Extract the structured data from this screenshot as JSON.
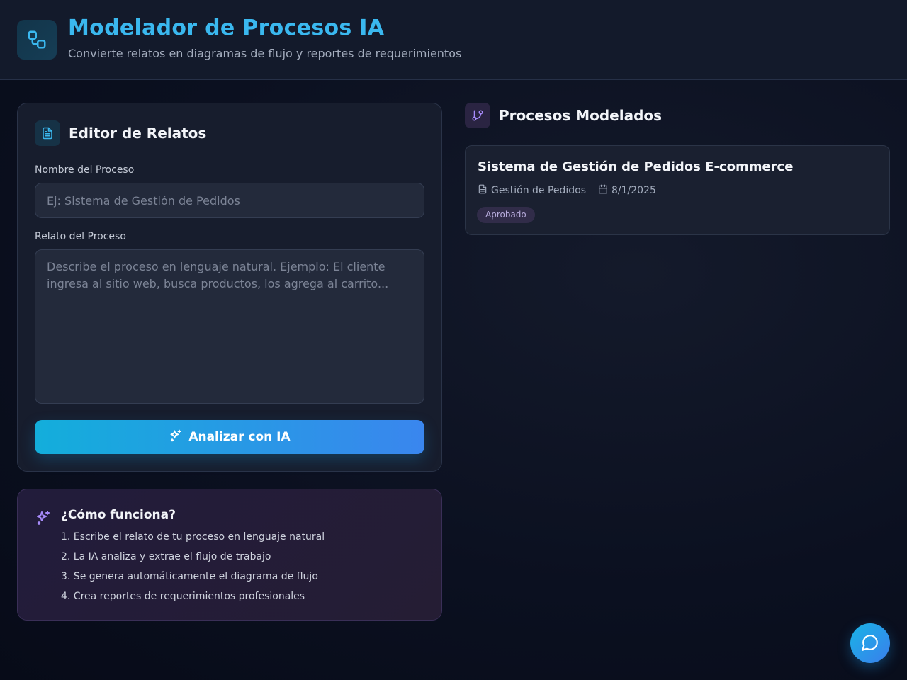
{
  "header": {
    "title": "Modelador de Procesos IA",
    "subtitle": "Convierte relatos en diagramas de flujo y reportes de requerimientos"
  },
  "editor": {
    "title": "Editor de Relatos",
    "name_label": "Nombre del Proceso",
    "name_placeholder": "Ej: Sistema de Gestión de Pedidos",
    "name_value": "",
    "story_label": "Relato del Proceso",
    "story_placeholder": "Describe el proceso en lenguaje natural. Ejemplo: El cliente ingresa al sitio web, busca productos, los agrega al carrito...",
    "story_value": "",
    "analyze_label": "Analizar con IA"
  },
  "how_it_works": {
    "title": "¿Cómo funciona?",
    "steps": [
      "1. Escribe el relato de tu proceso en lenguaje natural",
      "2. La IA analiza y extrae el flujo de trabajo",
      "3. Se genera automáticamente el diagrama de flujo",
      "4. Crea reportes de requerimientos profesionales"
    ]
  },
  "processes": {
    "title": "Procesos Modelados",
    "items": [
      {
        "title": "Sistema de Gestión de Pedidos E-commerce",
        "category": "Gestión de Pedidos",
        "date": "8/1/2025",
        "status": "Aprobado"
      }
    ]
  },
  "colors": {
    "accent": "#3ab8ef",
    "button_gradient_start": "#13aedb",
    "button_gradient_end": "#3a86ee",
    "purple_accent": "#a78bfa",
    "background": "#0b1020"
  },
  "icons": {
    "logo": "workflow-icon",
    "editor": "file-text-icon",
    "analyze": "sparkles-icon",
    "info": "sparkles-icon",
    "processes": "git-branch-icon",
    "category": "file-text-icon",
    "date": "calendar-icon",
    "chat": "message-circle-icon"
  }
}
